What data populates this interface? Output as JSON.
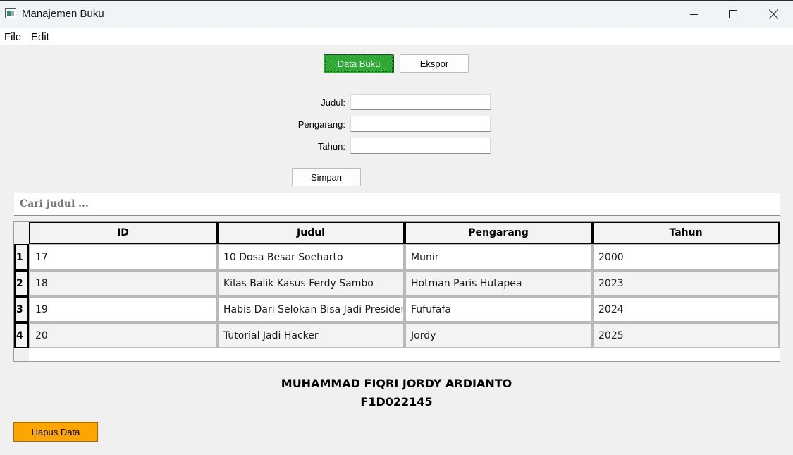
{
  "window": {
    "title": "Manajemen Buku",
    "icon": "app-window-icon",
    "controls": [
      "minimize-icon",
      "maximize-icon",
      "close-icon"
    ]
  },
  "menu": {
    "items": [
      "File",
      "Edit"
    ]
  },
  "toolbar": {
    "data_buku_label": "Data Buku",
    "ekspor_label": "Ekspor"
  },
  "form": {
    "judul_label": "Judul:",
    "pengarang_label": "Pengarang:",
    "tahun_label": "Tahun:",
    "judul_value": "",
    "pengarang_value": "",
    "tahun_value": "",
    "simpan_label": "Simpan"
  },
  "search": {
    "placeholder": "Cari judul ...",
    "value": ""
  },
  "table": {
    "columns": [
      "ID",
      "Judul",
      "Pengarang",
      "Tahun"
    ],
    "row_headers": [
      "1",
      "2",
      "3",
      "4"
    ],
    "rows": [
      [
        "17",
        "10 Dosa Besar Soeharto",
        "Munir",
        "2000"
      ],
      [
        "18",
        "Kilas Balik Kasus Ferdy Sambo",
        "Hotman Paris Hutapea",
        "2023"
      ],
      [
        "19",
        "Habis Dari Selokan Bisa Jadi Presiden",
        "Fufufafa",
        "2024"
      ],
      [
        "20",
        "Tutorial Jadi Hacker",
        "Jordy",
        "2025"
      ]
    ]
  },
  "footer": {
    "name": "MUHAMMAD FIQRI JORDY ARDIANTO",
    "nim": "F1D022145",
    "hapus_label": "Hapus Data"
  },
  "colors": {
    "active_button": "#22a32a",
    "delete_button": "#ffa500",
    "background": "#f0f0f0"
  }
}
